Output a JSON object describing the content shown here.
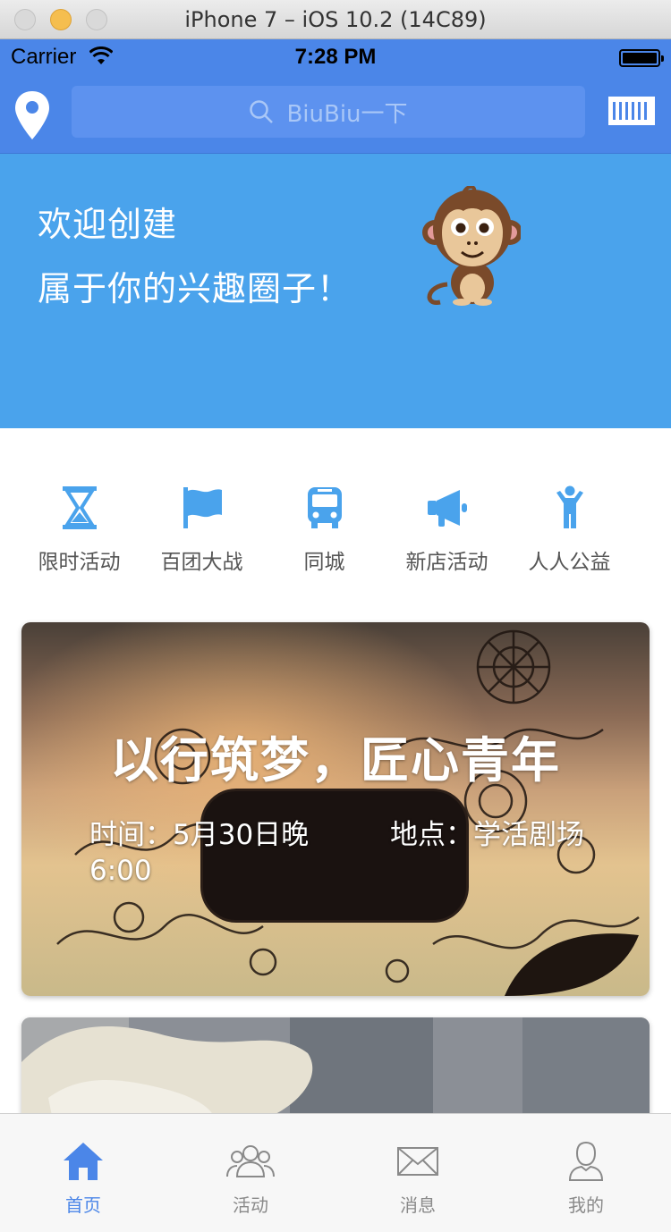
{
  "window": {
    "title": "iPhone 7 – iOS 10.2 (14C89)"
  },
  "status_bar": {
    "carrier": "Carrier",
    "time": "7:28 PM"
  },
  "nav": {
    "search_placeholder": "BiuBiu一下",
    "location_icon": "location-pin-icon",
    "scan_icon": "barcode-icon"
  },
  "banner": {
    "line1": "欢迎创建",
    "line2": "属于你的兴趣圈子！",
    "mascot": "monkey-icon"
  },
  "categories": [
    {
      "label": "限时活动",
      "icon": "hourglass-icon"
    },
    {
      "label": "百团大战",
      "icon": "flag-icon"
    },
    {
      "label": "同城",
      "icon": "bus-icon"
    },
    {
      "label": "新店活动",
      "icon": "megaphone-icon"
    },
    {
      "label": "人人公益",
      "icon": "person-icon"
    }
  ],
  "cards": [
    {
      "title": "以行筑梦，匠心青年",
      "time": "时间：5月30日晚6:00",
      "place": "地点：学活剧场"
    }
  ],
  "tabs": [
    {
      "label": "首页",
      "icon": "home-icon",
      "active": true
    },
    {
      "label": "活动",
      "icon": "group-icon",
      "active": false
    },
    {
      "label": "消息",
      "icon": "mail-icon",
      "active": false
    },
    {
      "label": "我的",
      "icon": "profile-icon",
      "active": false
    }
  ],
  "colors": {
    "primary": "#4b86e8",
    "banner": "#4aa3ec",
    "category_icon": "#4aa3ec",
    "tab_inactive": "#8a8a8a"
  }
}
